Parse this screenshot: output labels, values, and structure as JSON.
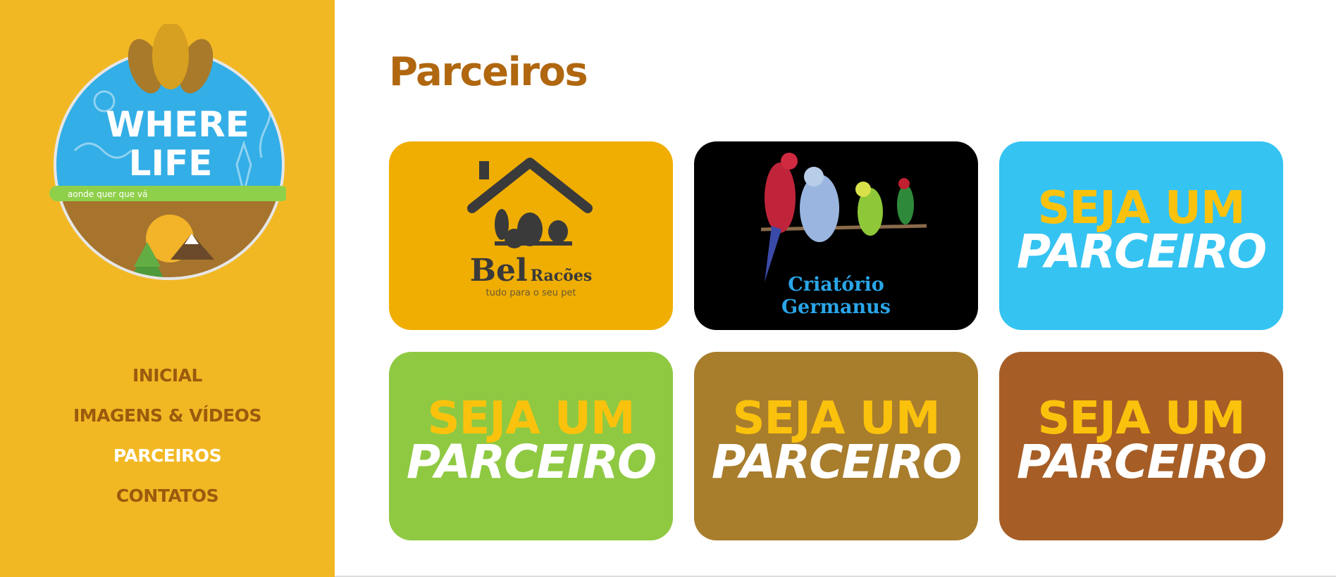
{
  "sidebar": {
    "logo": {
      "line1": "WHERE",
      "line2": "LIFE",
      "tagline": "aonde quer que vá"
    },
    "nav": [
      "INICIAL",
      "IMAGENS & VÍDEOS",
      "PARCEIROS",
      "CONTATOS"
    ],
    "active_nav": "PARCEIROS"
  },
  "main": {
    "title": "Parceiros",
    "cards": [
      {
        "type": "brand",
        "name_big": "Bel",
        "name_small": "Racões",
        "tagline": "tudo para o seu pet",
        "bg": "#f0ae03"
      },
      {
        "type": "brand",
        "line1": "Criatório",
        "line2": "Germanus",
        "bg": "#000000"
      },
      {
        "type": "cta",
        "top": "SEJA UM",
        "bottom": "PARCEIRO",
        "bg": "#35c3f2"
      },
      {
        "type": "cta",
        "top": "SEJA UM",
        "bottom": "PARCEIRO",
        "bg": "#8fc942"
      },
      {
        "type": "cta",
        "top": "SEJA UM",
        "bottom": "PARCEIRO",
        "bg": "#a87d2c"
      },
      {
        "type": "cta",
        "top": "SEJA UM",
        "bottom": "PARCEIRO",
        "bg": "#a65e26"
      }
    ]
  },
  "colors": {
    "sidebar_bg": "#f2b824",
    "nav_text": "#9a5a0e",
    "nav_active": "#ffffff",
    "title": "#b0670f",
    "cta_yellow": "#fbc20d"
  }
}
